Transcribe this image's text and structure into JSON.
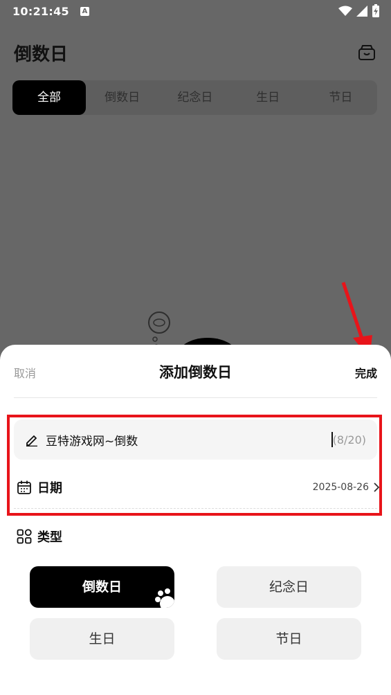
{
  "status_bar": {
    "time": "10:21:45",
    "notif_glyph": "A"
  },
  "app": {
    "title": "倒数日",
    "filter_tabs": [
      "全部",
      "倒数日",
      "纪念日",
      "生日",
      "节日"
    ]
  },
  "sheet": {
    "cancel_label": "取消",
    "title": "添加倒数日",
    "done_label": "完成",
    "name_value": "豆特游戏网~倒数",
    "name_counter": "(8/20)",
    "date_label": "日期",
    "date_value": "2025-08-26",
    "type_label": "类型",
    "types": [
      "倒数日",
      "纪念日",
      "生日",
      "节日"
    ]
  },
  "colors": {
    "accent": "#000000",
    "annotation": "#e8141a"
  }
}
